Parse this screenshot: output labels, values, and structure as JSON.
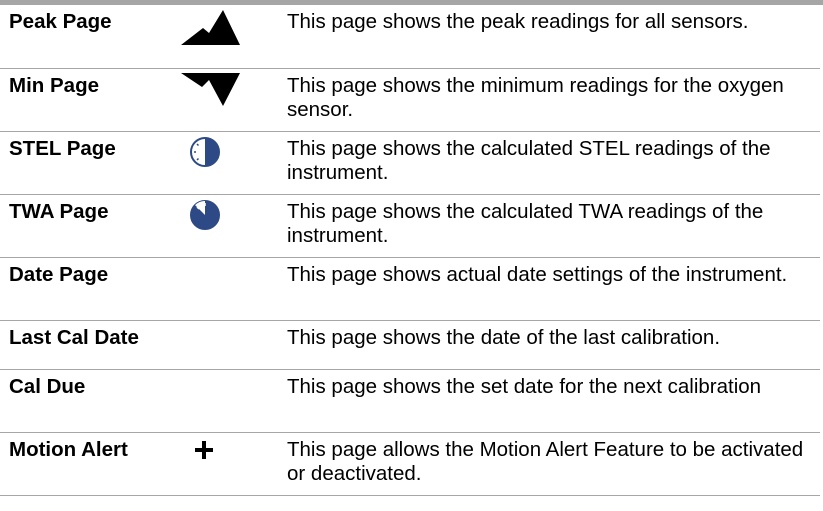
{
  "rows": [
    {
      "name": "Peak Page",
      "icon": "peak-icon",
      "desc": "This page shows the peak readings for all sensors."
    },
    {
      "name": "Min Page",
      "icon": "min-icon",
      "desc": "This page shows the minimum readings for the oxygen sensor."
    },
    {
      "name": "STEL Page",
      "icon": "stel-clock-icon",
      "desc": "This page shows the calculated STEL readings of the instrument."
    },
    {
      "name": "TWA Page",
      "icon": "twa-clock-icon",
      "desc": "This page shows the calculated TWA readings of the instrument."
    },
    {
      "name": "Date Page",
      "icon": "",
      "desc": "This page shows actual date settings of the instrument."
    },
    {
      "name": "Last Cal Date",
      "icon": "",
      "desc": "This page shows the date of the last calibration."
    },
    {
      "name": "Cal Due",
      "icon": "",
      "desc": "This page shows the set date for the next calibration"
    },
    {
      "name": "Motion Alert",
      "icon": "plus-icon",
      "desc": "This page allows the Motion Alert Feature to be activated or deactivated."
    }
  ],
  "colors": {
    "rule": "#a6a6a6",
    "icon_fill": "#000000",
    "clock_fill": "#2e4a86"
  }
}
